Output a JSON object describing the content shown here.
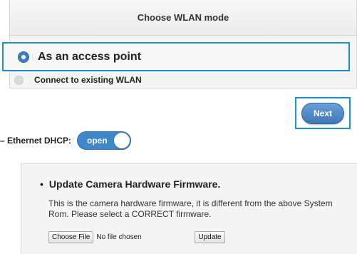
{
  "wlan": {
    "title": "Choose WLAN mode",
    "options": [
      {
        "label": "As an access point",
        "selected": true
      },
      {
        "label": "Connect to existing WLAN",
        "selected": false
      }
    ],
    "next_label": "Next"
  },
  "dhcp": {
    "label": "– Ethernet DHCP:",
    "toggle_state": "open"
  },
  "firmware": {
    "title": "Update Camera Hardware Firmware.",
    "description": "This is the camera hardware firmware, it is different from the above System Rom. Please select a CORRECT firmware.",
    "choose_file_label": "Choose File",
    "file_status": "No file chosen",
    "update_label": "Update"
  },
  "colors": {
    "accent": "#3f87c9",
    "highlight_border": "#1a8fd6"
  }
}
